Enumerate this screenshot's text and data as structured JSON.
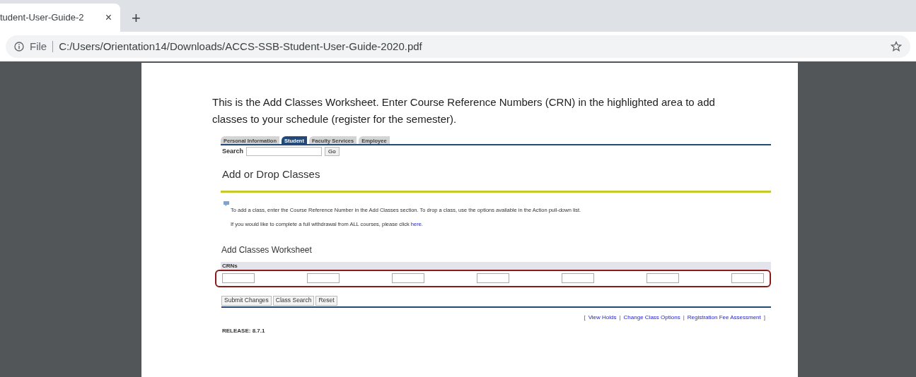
{
  "browser": {
    "tab_title": "tudent-User-Guide-2",
    "close": "×",
    "new_tab": "+",
    "site_info": "File",
    "address": "C:/Users/Orientation14/Downloads/ACCS-SSB-Student-User-Guide-2020.pdf"
  },
  "document": {
    "intro": "This is the Add Classes Worksheet.  Enter Course Reference Numbers (CRN) in the highlighted area to add classes to your schedule (register for the semester).",
    "tabs": [
      {
        "label": "Personal Information",
        "selected": false
      },
      {
        "label": "Student",
        "selected": true
      },
      {
        "label": "Faculty Services",
        "selected": false
      },
      {
        "label": "Employee",
        "selected": false
      }
    ],
    "search_label": "Search",
    "go_button": "Go",
    "heading": "Add or Drop Classes",
    "info_text": "To add a class, enter the Course Reference Number in the Add Classes section. To drop a class, use the options available in the Action pull-down list.",
    "withdraw_text": "If you would like to complete a full withdrawal from ALL courses, please click ",
    "withdraw_link": "here",
    "withdraw_end": ".",
    "worksheet_heading": "Add Classes Worksheet",
    "crns_label": "CRNs",
    "buttons": [
      "Submit Changes",
      "Class Search",
      "Reset"
    ],
    "footer": [
      {
        "kind": "text",
        "text": "["
      },
      {
        "kind": "link",
        "text": "View Holds"
      },
      {
        "kind": "text",
        "text": "|"
      },
      {
        "kind": "link",
        "text": "Change Class Options"
      },
      {
        "kind": "text",
        "text": "|"
      },
      {
        "kind": "link",
        "text": "Registration Fee Assessment"
      },
      {
        "kind": "text",
        "text": "]"
      }
    ],
    "release": "RELEASE: 8.7.1"
  }
}
